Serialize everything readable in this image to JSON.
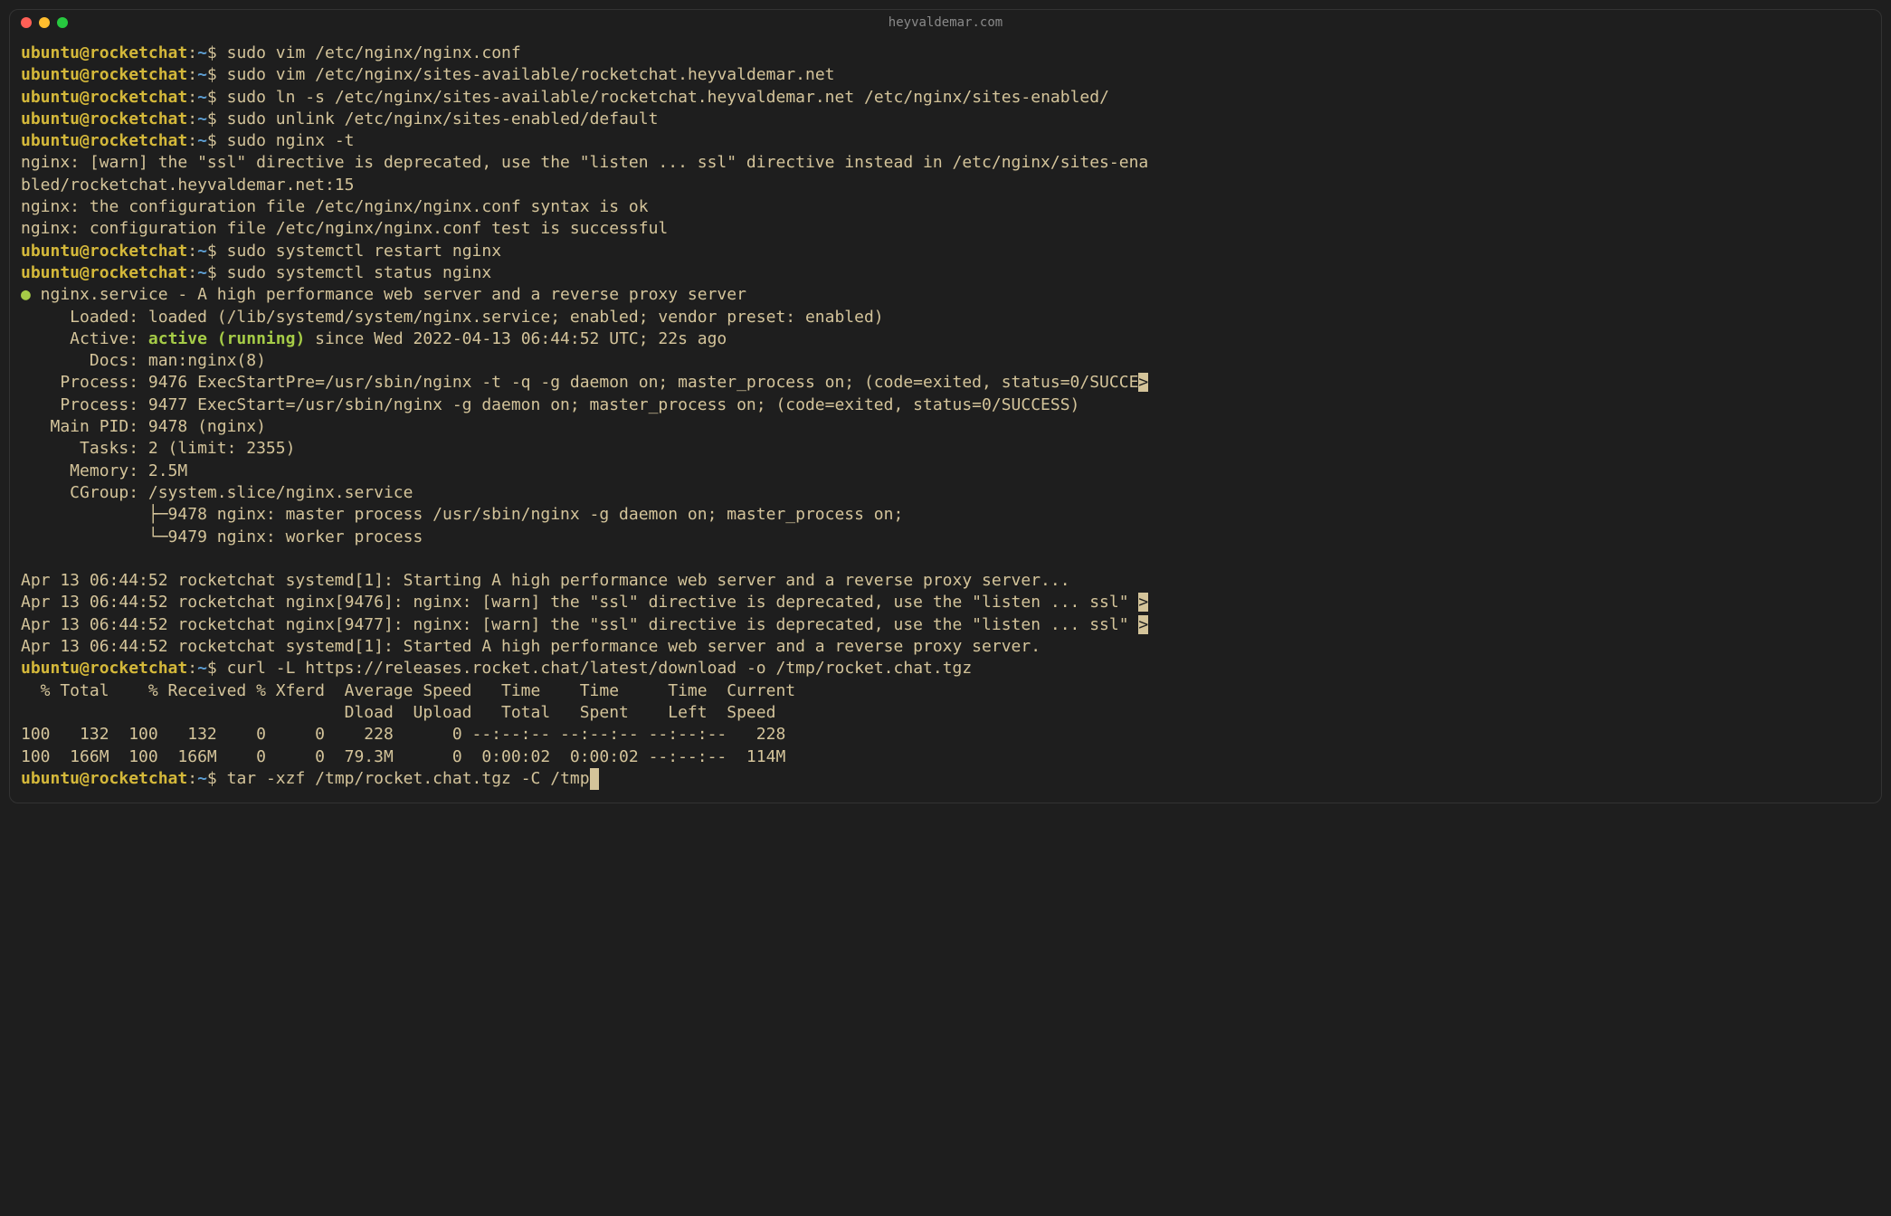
{
  "window": {
    "title": "heyvaldemar.com"
  },
  "prompt": {
    "user": "ubuntu@rocketchat",
    "sep": ":",
    "path": "~",
    "dollar": "$"
  },
  "commands": {
    "cmd1": "sudo vim /etc/nginx/nginx.conf",
    "cmd2": "sudo vim /etc/nginx/sites-available/rocketchat.heyvaldemar.net",
    "cmd3": "sudo ln -s /etc/nginx/sites-available/rocketchat.heyvaldemar.net /etc/nginx/sites-enabled/",
    "cmd4": "sudo unlink /etc/nginx/sites-enabled/default",
    "cmd5": "sudo nginx -t",
    "cmd6": "sudo systemctl restart nginx",
    "cmd7": "sudo systemctl status nginx",
    "cmd8": "curl -L https://releases.rocket.chat/latest/download -o /tmp/rocket.chat.tgz",
    "cmd9": "tar -xzf /tmp/rocket.chat.tgz -C /tmp"
  },
  "output": {
    "nginx_warn1": "nginx: [warn] the \"ssl\" directive is deprecated, use the \"listen ... ssl\" directive instead in /etc/nginx/sites-ena",
    "nginx_warn2": "bled/rocketchat.heyvaldemar.net:15",
    "nginx_ok": "nginx: the configuration file /etc/nginx/nginx.conf syntax is ok",
    "nginx_success": "nginx: configuration file /etc/nginx/nginx.conf test is successful",
    "status_bullet": "●",
    "status_service": " nginx.service - A high performance web server and a reverse proxy server",
    "status_loaded": "     Loaded: loaded (/lib/systemd/system/nginx.service; enabled; vendor preset: enabled)",
    "status_active_label": "     Active: ",
    "status_active_value": "active (running)",
    "status_active_since": " since Wed 2022-04-13 06:44:52 UTC; 22s ago",
    "status_docs": "       Docs: man:nginx(8)",
    "status_process1_pre": "    Process: 9476 ExecStartPre=/usr/sbin/nginx -t -q -g daemon on; master_process on; (code=exited, status=0/SUCCE",
    "status_process1_suf": ">",
    "status_process2": "    Process: 9477 ExecStart=/usr/sbin/nginx -g daemon on; master_process on; (code=exited, status=0/SUCCESS)",
    "status_mainpid": "   Main PID: 9478 (nginx)",
    "status_tasks": "      Tasks: 2 (limit: 2355)",
    "status_memory": "     Memory: 2.5M",
    "status_cgroup": "     CGroup: /system.slice/nginx.service",
    "status_tree1": "             ├─9478 nginx: master process /usr/sbin/nginx -g daemon on; master_process on;",
    "status_tree2": "             └─9479 nginx: worker process",
    "log1": "Apr 13 06:44:52 rocketchat systemd[1]: Starting A high performance web server and a reverse proxy server...",
    "log2_pre": "Apr 13 06:44:52 rocketchat nginx[9476]: nginx: [warn] the \"ssl\" directive is deprecated, use the \"listen ... ssl\" ",
    "log2_suf": ">",
    "log3_pre": "Apr 13 06:44:52 rocketchat nginx[9477]: nginx: [warn] the \"ssl\" directive is deprecated, use the \"listen ... ssl\" ",
    "log3_suf": ">",
    "log4": "Apr 13 06:44:52 rocketchat systemd[1]: Started A high performance web server and a reverse proxy server.",
    "curl_header": "  % Total    % Received % Xferd  Average Speed   Time    Time     Time  Current",
    "curl_header2": "                                 Dload  Upload   Total   Spent    Left  Speed",
    "curl_row1": "100   132  100   132    0     0    228      0 --:--:-- --:--:-- --:--:--   228",
    "curl_row2": "100  166M  100  166M    0     0  79.3M      0  0:00:02  0:00:02 --:--:--  114M",
    "cursor": " "
  }
}
